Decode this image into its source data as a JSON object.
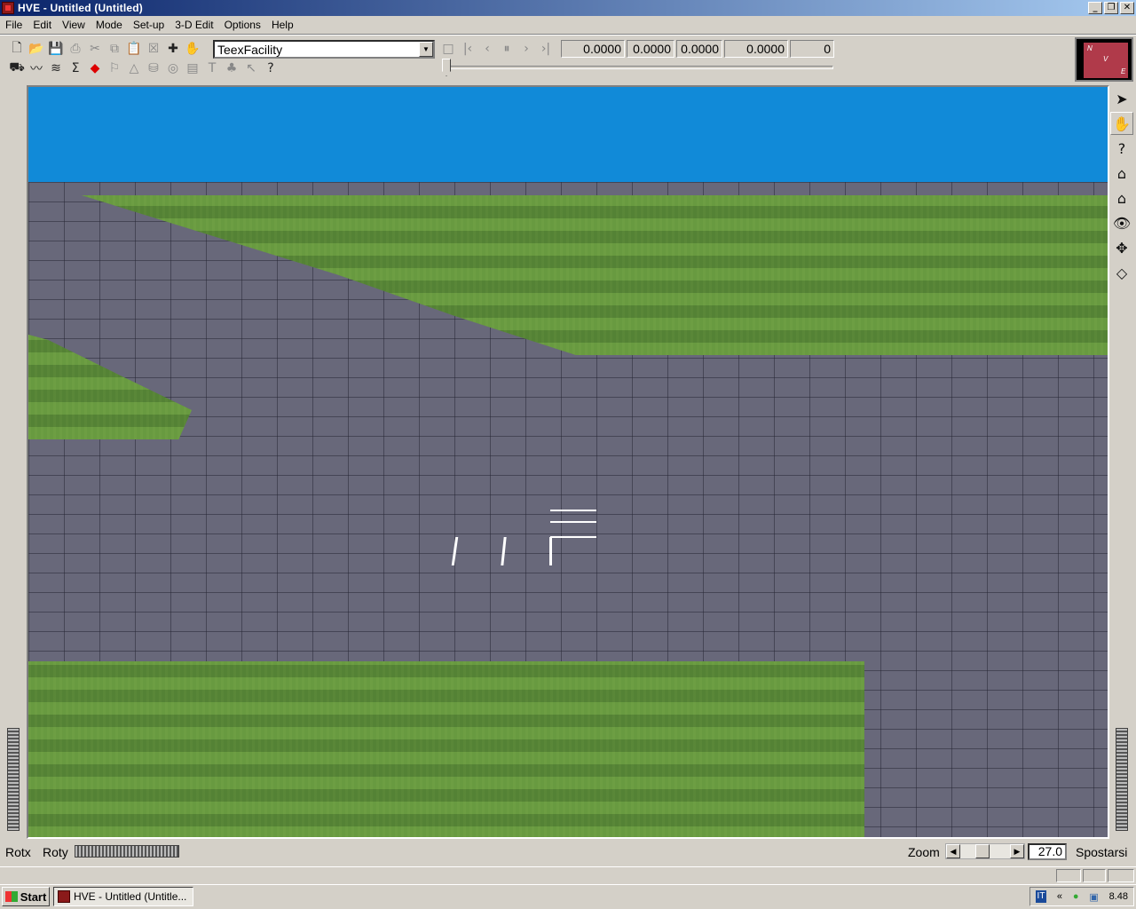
{
  "window": {
    "title": "HVE - Untitled (Untitled)",
    "controls": [
      "_",
      "❐",
      "✕"
    ]
  },
  "menu": [
    "File",
    "Edit",
    "View",
    "Mode",
    "Set-up",
    "3-D Edit",
    "Options",
    "Help"
  ],
  "toolbar": {
    "object_select": "TeexFacility",
    "readouts": [
      "0.0000",
      "0.0000",
      "0.0000",
      "0.0000",
      "0"
    ]
  },
  "compass": {
    "n": "N",
    "v": "V",
    "e": "E"
  },
  "bottom": {
    "rotx_label": "Rotx",
    "roty_label": "Roty",
    "zoom_label": "Zoom",
    "zoom_value": "27.0",
    "spostarsi_label": "Spostarsi"
  },
  "taskbar": {
    "start_label": "Start",
    "task_label": "HVE - Untitled (Untitle...",
    "clock": "8.48",
    "lang": "IT"
  },
  "colors": {
    "sky": "#118ad8",
    "grass": "#5b8d3c",
    "pavement": "#68687a",
    "title_bar": "#0a246a"
  }
}
